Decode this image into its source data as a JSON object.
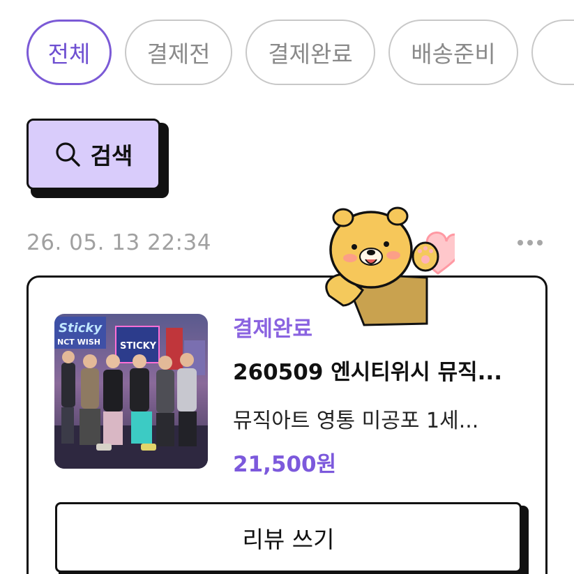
{
  "filters": {
    "chips": [
      {
        "label": "전체",
        "active": true
      },
      {
        "label": "결제전",
        "active": false
      },
      {
        "label": "결제완료",
        "active": false
      },
      {
        "label": "배송준비",
        "active": false
      },
      {
        "label": "",
        "active": false
      }
    ]
  },
  "search": {
    "label": "검색",
    "icon": "search-icon"
  },
  "order": {
    "timestamp": "26. 05. 13 22:34",
    "more_icon": "more-horizontal-icon",
    "status": "결제완료",
    "title": "260509 엔시티위시 뮤직...",
    "subtitle": "뮤직아트 영통 미공포 1세...",
    "price": "21,500원",
    "thumbnail_texts": {
      "sign_left": "Sticky",
      "sign_sub": "NCT WISH",
      "sign_right": "STICKY"
    },
    "review_button": "리뷰 쓰기"
  },
  "colors": {
    "accent": "#7b5ad6",
    "search_bg": "#d9ccfb",
    "timestamp": "#a0a0a0",
    "chip_border": "#c8c8c8"
  }
}
